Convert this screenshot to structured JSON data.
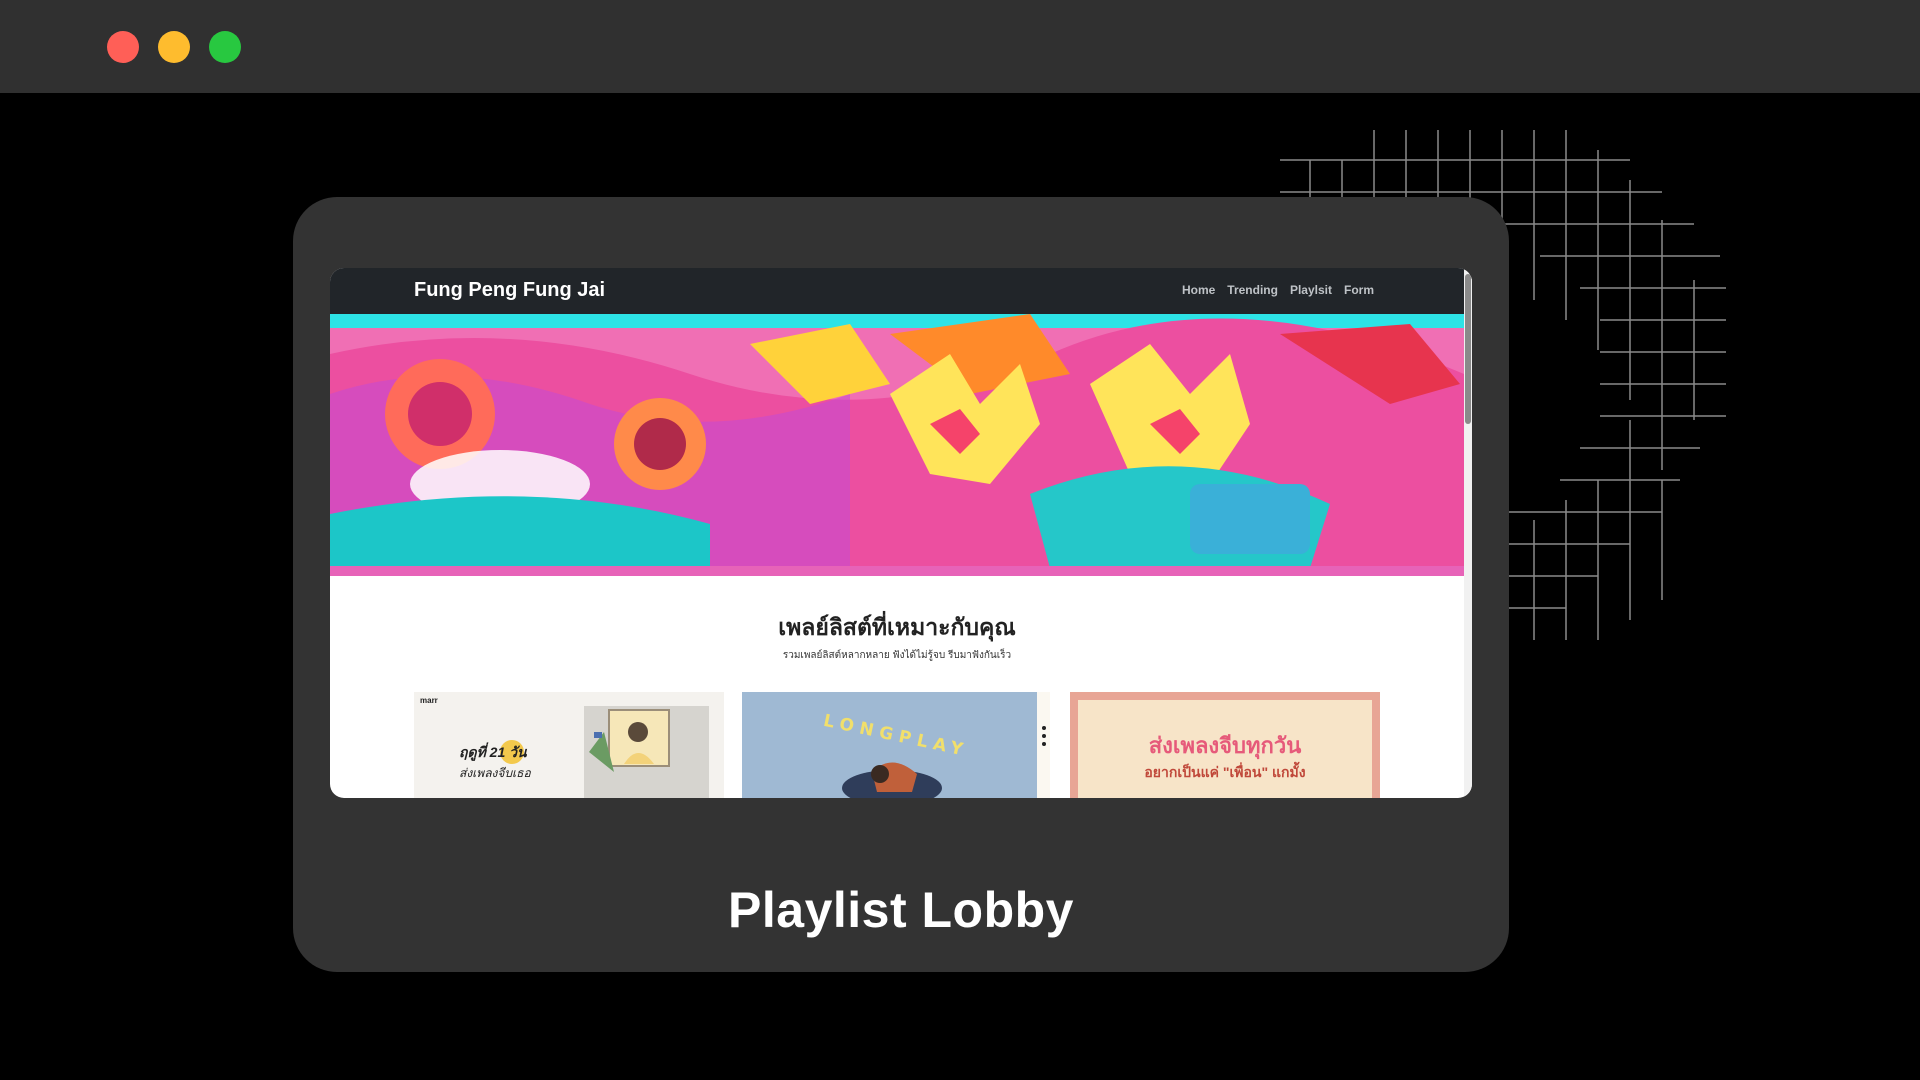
{
  "window": {
    "controls": [
      "close",
      "minimize",
      "maximize"
    ],
    "colors": {
      "close": "#ff5f57",
      "minimize": "#febc2e",
      "maximize": "#28c840"
    }
  },
  "card": {
    "caption": "Playlist Lobby"
  },
  "site": {
    "brand": "Fung Peng Fung Jai",
    "nav": [
      "Home",
      "Trending",
      "Playlsit",
      "Form"
    ],
    "section_title": "เพลย์ลิสต์ที่เหมาะกับคุณ",
    "section_subtitle": "รวมเพลย์ลิสต์หลากหลาย ฟังได้ไม่รู้จบ รีบมาฟังกันเร็ว",
    "playlists": [
      {
        "publisher": "marr",
        "title_line1": "ฤดูที่ 21 วัน",
        "title_line2": "ส่งเพลงจีบเธอ"
      },
      {
        "title": "LONGPLAY"
      },
      {
        "title_line1": "ส่งเพลงจีบทุกวัน",
        "title_line2": "อยากเป็นแค่ \"เพื่อน\" แกมั้ง"
      }
    ]
  }
}
